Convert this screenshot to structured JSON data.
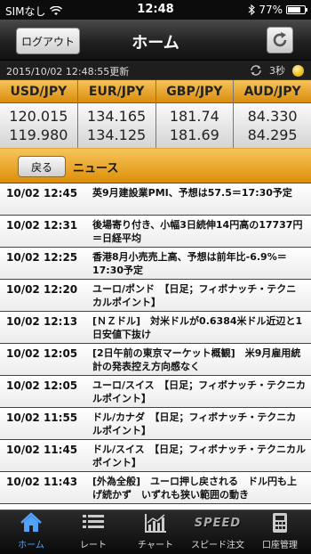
{
  "status_bar": {
    "carrier": "SIMなし",
    "time": "12:48",
    "battery": "77%",
    "battery_level": 0.77
  },
  "header": {
    "logout_label": "ログアウト",
    "title": "ホーム"
  },
  "update_bar": {
    "timestamp": "2015/10/02 12:48:55更新",
    "interval": "3秒"
  },
  "rates": [
    {
      "pair": "USD/JPY",
      "bid": "120.015",
      "ask": "119.980"
    },
    {
      "pair": "EUR/JPY",
      "bid": "134.165",
      "ask": "134.125"
    },
    {
      "pair": "GBP/JPY",
      "bid": "181.74",
      "ask": "181.69"
    },
    {
      "pair": "AUD/JPY",
      "bid": "84.330",
      "ask": "84.295"
    }
  ],
  "section": {
    "back_label": "戻る",
    "title": "ニュース"
  },
  "news": [
    {
      "time": "10/02 12:45",
      "headline": "英9月建設業PMI、予想は57.5＝17:30予定"
    },
    {
      "time": "10/02 12:31",
      "headline": "後場寄り付き、小幅3日続伸14円高の17737円＝日経平均"
    },
    {
      "time": "10/02 12:25",
      "headline": "香港8月小売売上高、予想は前年比-6.9%＝17:30予定"
    },
    {
      "time": "10/02 12:20",
      "headline": "ユーロ/ポンド　【日足；フィボナッチ・テクニカルポイント】"
    },
    {
      "time": "10/02 12:13",
      "headline": "[ＮＺドル]　対米ドルが0.6384米ドル近辺と1日安値下抜け"
    },
    {
      "time": "10/02 12:05",
      "headline": "[2日午前の東京マーケット概観]　米9月雇用統計の発表控え方向感なく"
    },
    {
      "time": "10/02 12:05",
      "headline": "ユーロ/スイス　【日足；フィボナッチ・テクニカルポイント】"
    },
    {
      "time": "10/02 11:55",
      "headline": "ドル/カナダ　【日足；フィボナッチ・テクニカルポイント】"
    },
    {
      "time": "10/02 11:45",
      "headline": "ドル/スイス　【日足；フィボナッチ・テクニカルポイント】"
    },
    {
      "time": "10/02 11:43",
      "headline": "[外為全般]　ユーロ押し戻される　ドル円も上げ続かず　いずれも狭い範囲の動き"
    }
  ],
  "tabs": [
    {
      "label": "ホーム",
      "icon": "home-icon",
      "active": true
    },
    {
      "label": "レート",
      "icon": "list-icon",
      "active": false
    },
    {
      "label": "チャート",
      "icon": "chart-icon",
      "active": false
    },
    {
      "label": "スピード注文",
      "icon": "speed-icon",
      "logo": "SPEED",
      "active": false
    },
    {
      "label": "口座管理",
      "icon": "calculator-icon",
      "active": false
    }
  ],
  "colors": {
    "accent_orange": "#e89a1c",
    "active_tab": "#4fa3ff"
  }
}
